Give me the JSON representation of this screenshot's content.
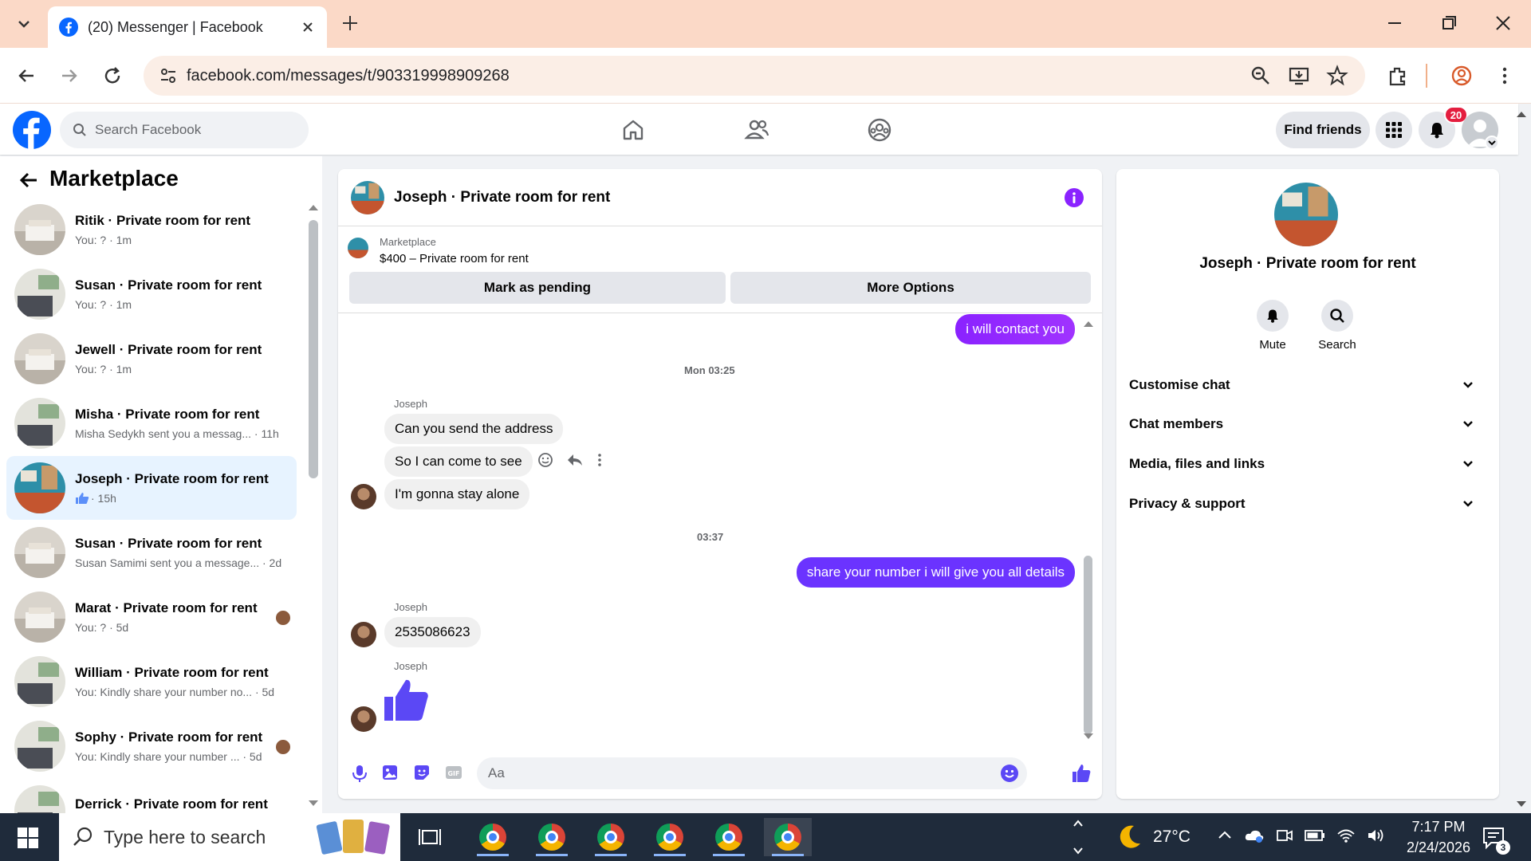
{
  "browser": {
    "tab_title": "(20) Messenger | Facebook",
    "url": "facebook.com/messages/t/903319998909268"
  },
  "fb": {
    "search_placeholder": "Search Facebook",
    "find_friends": "Find friends",
    "notification_count": "20"
  },
  "sidebar": {
    "title": "Marketplace",
    "conversations": [
      {
        "name": "Ritik · Private room for rent",
        "sub": "You: ? · 1m"
      },
      {
        "name": "Susan · Private room for rent",
        "sub": "You: ? · 1m"
      },
      {
        "name": "Jewell · Private room for rent",
        "sub": "You: ? · 1m"
      },
      {
        "name": "Misha · Private room for rent",
        "sub": "Misha Sedykh sent you a messag... · 11h"
      },
      {
        "name": "Joseph · Private room for rent",
        "sub": "· 15h"
      },
      {
        "name": "Susan · Private room for rent",
        "sub": "Susan Samimi sent you a message... · 2d"
      },
      {
        "name": "Marat · Private room for rent",
        "sub": "You: ? · 5d"
      },
      {
        "name": "William · Private room for rent",
        "sub": "You: Kindly share your number no... · 5d"
      },
      {
        "name": "Sophy · Private room for rent",
        "sub": "You: Kindly share your number ... · 5d"
      },
      {
        "name": "Derrick · Private room for rent",
        "sub": ""
      }
    ]
  },
  "chat": {
    "title": "Joseph · Private room for rent",
    "listing_source": "Marketplace",
    "listing_title": "$400 – Private room for rent",
    "mark_pending": "Mark as pending",
    "more_options": "More Options",
    "messages": {
      "out1": "i will contact you",
      "ts1": "Mon 03:25",
      "sender1": "Joseph",
      "in1": "Can you send the address",
      "in2": "So I can come to see",
      "in3": "I'm gonna stay alone",
      "ts2": "03:37",
      "out2": "share your number i will give you all details",
      "sender2": "Joseph",
      "in4": "2535086623",
      "sender3": "Joseph"
    },
    "composer_placeholder": "Aa"
  },
  "info": {
    "title": "Joseph · Private room for rent",
    "mute": "Mute",
    "search": "Search",
    "sections": [
      "Customise chat",
      "Chat members",
      "Media, files and links",
      "Privacy & support"
    ]
  },
  "taskbar": {
    "search_placeholder": "Type here to search",
    "weather": "27°C",
    "time": "7:17 PM",
    "date": "2/24/2026",
    "notif": "3"
  },
  "colors": {
    "fb_blue": "#0866ff",
    "messenger_purple": "#8a22ff",
    "active_row": "#e7f3ff"
  }
}
